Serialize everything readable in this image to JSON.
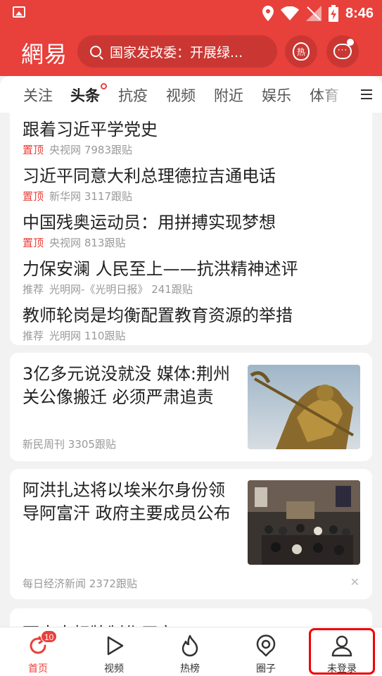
{
  "status_bar": {
    "time": "8:46"
  },
  "header": {
    "logo": "網易",
    "search_text": "国家发改委：开展绿...",
    "hot_label": "热",
    "message_label": "···"
  },
  "tabs": [
    {
      "label": "关注"
    },
    {
      "label": "头条"
    },
    {
      "label": "抗疫"
    },
    {
      "label": "视频"
    },
    {
      "label": "附近"
    },
    {
      "label": "娱乐"
    },
    {
      "label": "体育"
    }
  ],
  "top_news": [
    {
      "title": "跟着习近平学党史",
      "pin": "置顶",
      "source": "央视网",
      "comments": "7983跟贴"
    },
    {
      "title": "习近平同意大利总理德拉吉通电话",
      "pin": "置顶",
      "source": "新华网",
      "comments": "3117跟贴"
    },
    {
      "title": "中国残奥运动员：用拼搏实现梦想",
      "pin": "置顶",
      "source": "央视网",
      "comments": "813跟贴"
    },
    {
      "title": "力保安澜 人民至上——抗洪精神述评",
      "tag": "推荐",
      "source": "光明网-《光明日报》",
      "comments": "241跟贴"
    },
    {
      "title": "教师轮岗是均衡配置教育资源的举措",
      "tag": "推荐",
      "source": "光明网",
      "comments": "110跟贴"
    }
  ],
  "feed": [
    {
      "title": "3亿多元说没就没 媒体:荆州关公像搬迁 必须严肃追责",
      "source": "新民周刊",
      "comments": "3305跟贴",
      "image": "statue-photo"
    },
    {
      "title": "阿洪扎达将以埃米尔身份领导阿富汗 政府主要成员公布",
      "source": "每日经济新闻",
      "comments": "2372跟贴",
      "image": "press-conference-photo"
    }
  ],
  "partial_title": "西南大标牌制作厂家",
  "bottom_nav": [
    {
      "label": "首页",
      "badge": "10"
    },
    {
      "label": "视频"
    },
    {
      "label": "热榜"
    },
    {
      "label": "圈子"
    },
    {
      "label": "未登录"
    }
  ],
  "colors": {
    "brand_red": "#e8403b",
    "highlight_box": "#e00000"
  }
}
